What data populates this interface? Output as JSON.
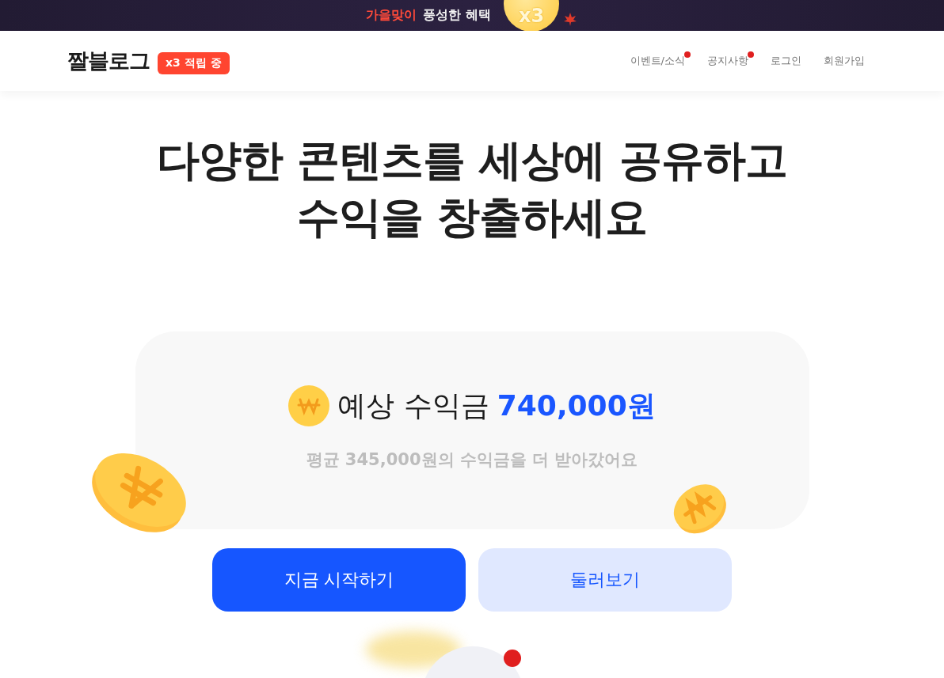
{
  "banner": {
    "highlight": "가을맞이",
    "text": "풍성한 혜택",
    "badge": "x3"
  },
  "header": {
    "logo": "짤블로그",
    "badge": "x3 적립 중",
    "nav": [
      {
        "label": "이벤트/소식",
        "new": true
      },
      {
        "label": "공지사항",
        "new": true
      },
      {
        "label": "로그인",
        "new": false
      },
      {
        "label": "회원가입",
        "new": false
      }
    ]
  },
  "hero": {
    "title_lines": [
      "다양한 콘텐츠를 세상에 공유하고",
      "수익을 창출하세요"
    ]
  },
  "earnings": {
    "label": "예상 수익금",
    "amount": "740,000원",
    "note": "평균 345,000원의 수익금을 더 받아갔어요"
  },
  "buttons": [
    {
      "label": "지금 시작하기",
      "kind": "primary"
    },
    {
      "label": "둘러보기",
      "kind": "secondary"
    }
  ]
}
